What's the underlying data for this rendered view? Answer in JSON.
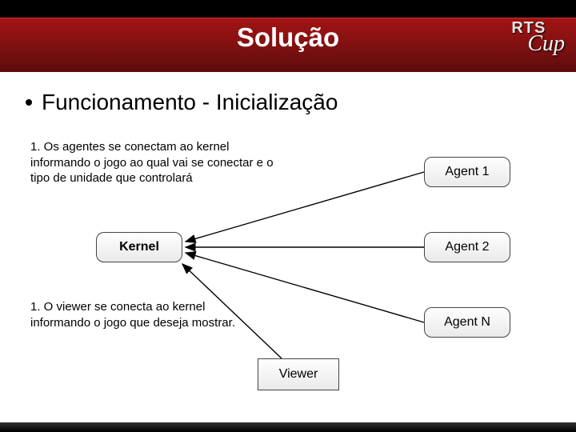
{
  "header": {
    "title": "Solução",
    "logo_line1": "RTS",
    "logo_line2": "Cup"
  },
  "content": {
    "subheading": "Funcionamento - Inicialização"
  },
  "diagram": {
    "note_agents": "1. Os agentes se conectam ao kernel informando o jogo ao qual vai se conectar e o tipo de unidade que controlará",
    "note_viewer": "1. O viewer se conecta ao kernel informando o jogo que deseja mostrar.",
    "kernel_label": "Kernel",
    "agent1_label": "Agent 1",
    "agent2_label": "Agent 2",
    "agentn_label": "Agent N",
    "viewer_label": "Viewer"
  }
}
